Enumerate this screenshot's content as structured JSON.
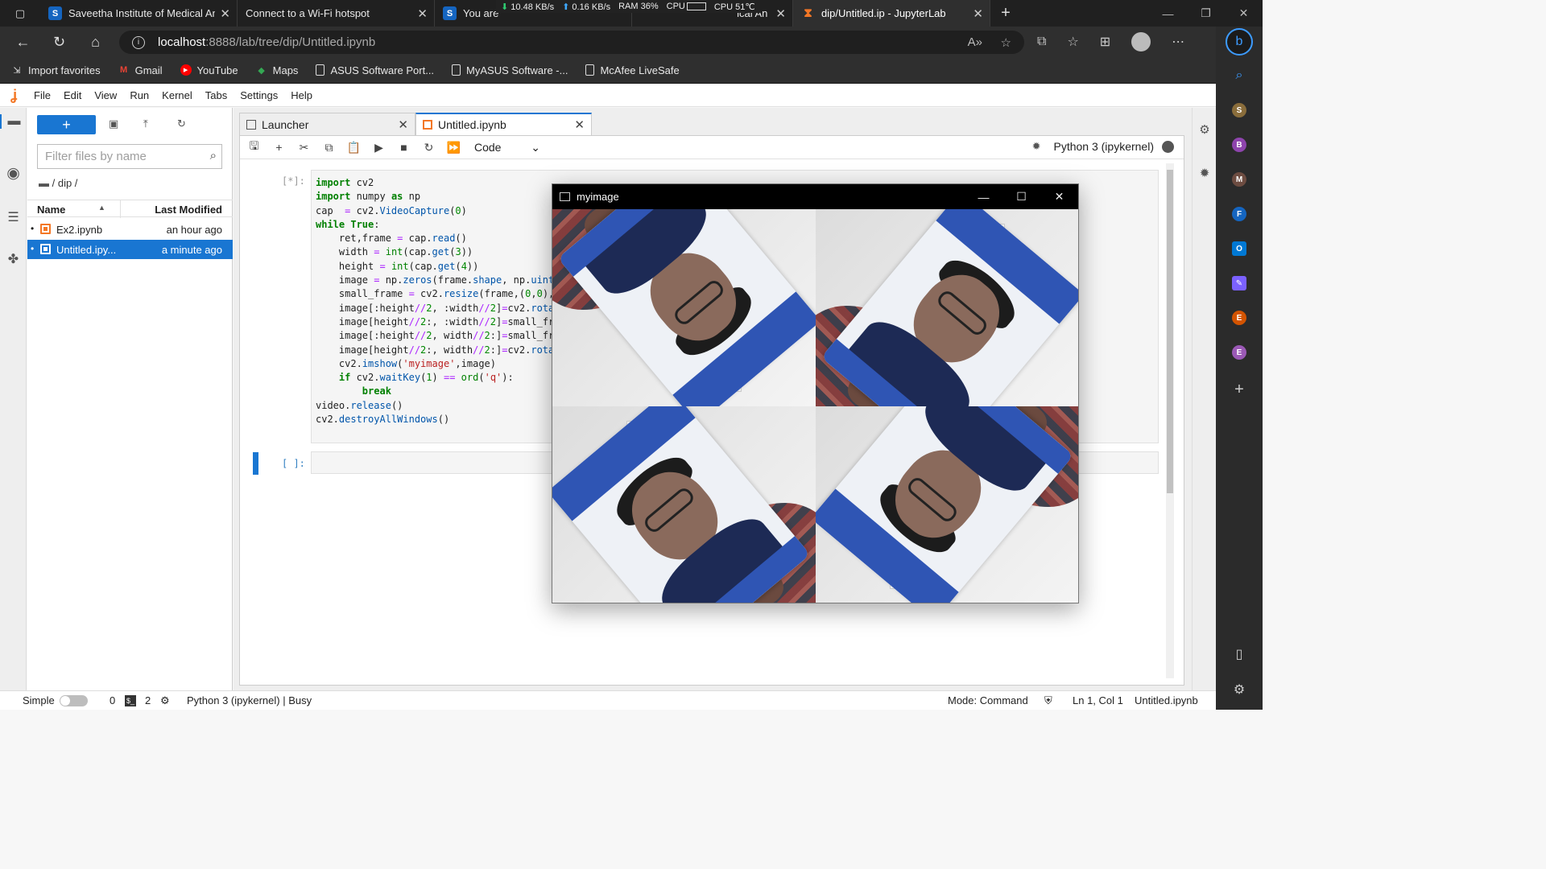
{
  "browser": {
    "tabs": [
      {
        "title": "Saveetha Institute of Medical An",
        "favicon": "S",
        "active": false
      },
      {
        "title": "Connect to a Wi-Fi hotspot",
        "favicon": "",
        "active": false
      },
      {
        "title": "You are",
        "favicon": "S",
        "active": false
      },
      {
        "title": "ical An",
        "favicon": "",
        "active": false
      },
      {
        "title": "dip/Untitled.ip - JupyterLab",
        "favicon": "hourglass",
        "active": true
      }
    ],
    "system_stats": {
      "down": "10.48 KB/s",
      "up": "0.16 KB/s",
      "ram": "RAM 36%",
      "cpu_label": "CPU",
      "cpu_temp": "CPU 51℃"
    },
    "url": {
      "host": "localhost",
      "rest": ":8888/lab/tree/dip/Untitled.ipynb"
    },
    "bookmarks": [
      "Import favorites",
      "Gmail",
      "YouTube",
      "Maps",
      "ASUS Software Port...",
      "MyASUS Software -...",
      "McAfee LiveSafe"
    ],
    "sidebar_avatars": [
      "S",
      "B",
      "M",
      "F",
      "E",
      "E"
    ],
    "accent": "#1976d2"
  },
  "jupyter": {
    "menu": [
      "File",
      "Edit",
      "View",
      "Run",
      "Kernel",
      "Tabs",
      "Settings",
      "Help"
    ],
    "file_browser": {
      "filter_placeholder": "Filter files by name",
      "breadcrumb": "/ dip /",
      "col_name": "Name",
      "col_modified": "Last Modified",
      "files": [
        {
          "name": "Ex2.ipynb",
          "modified": "an hour ago",
          "selected": false
        },
        {
          "name": "Untitled.ipy...",
          "modified": "a minute ago",
          "selected": true
        }
      ]
    },
    "doc_tabs": [
      {
        "label": "Launcher",
        "active": false
      },
      {
        "label": "Untitled.ipynb",
        "active": true
      }
    ],
    "cell_type": "Code",
    "kernel_name": "Python 3 (ipykernel)",
    "cells": [
      {
        "prompt": "[*]:"
      },
      {
        "prompt": "[ ]:"
      }
    ],
    "status": {
      "mode_label": "Simple",
      "count_a": "0",
      "count_b": "2",
      "kernel_status": "Python 3 (ipykernel) | Busy",
      "mode": "Mode: Command",
      "position": "Ln 1, Col 1",
      "file": "Untitled.ipynb"
    }
  },
  "cv_window": {
    "title": "myimage"
  }
}
